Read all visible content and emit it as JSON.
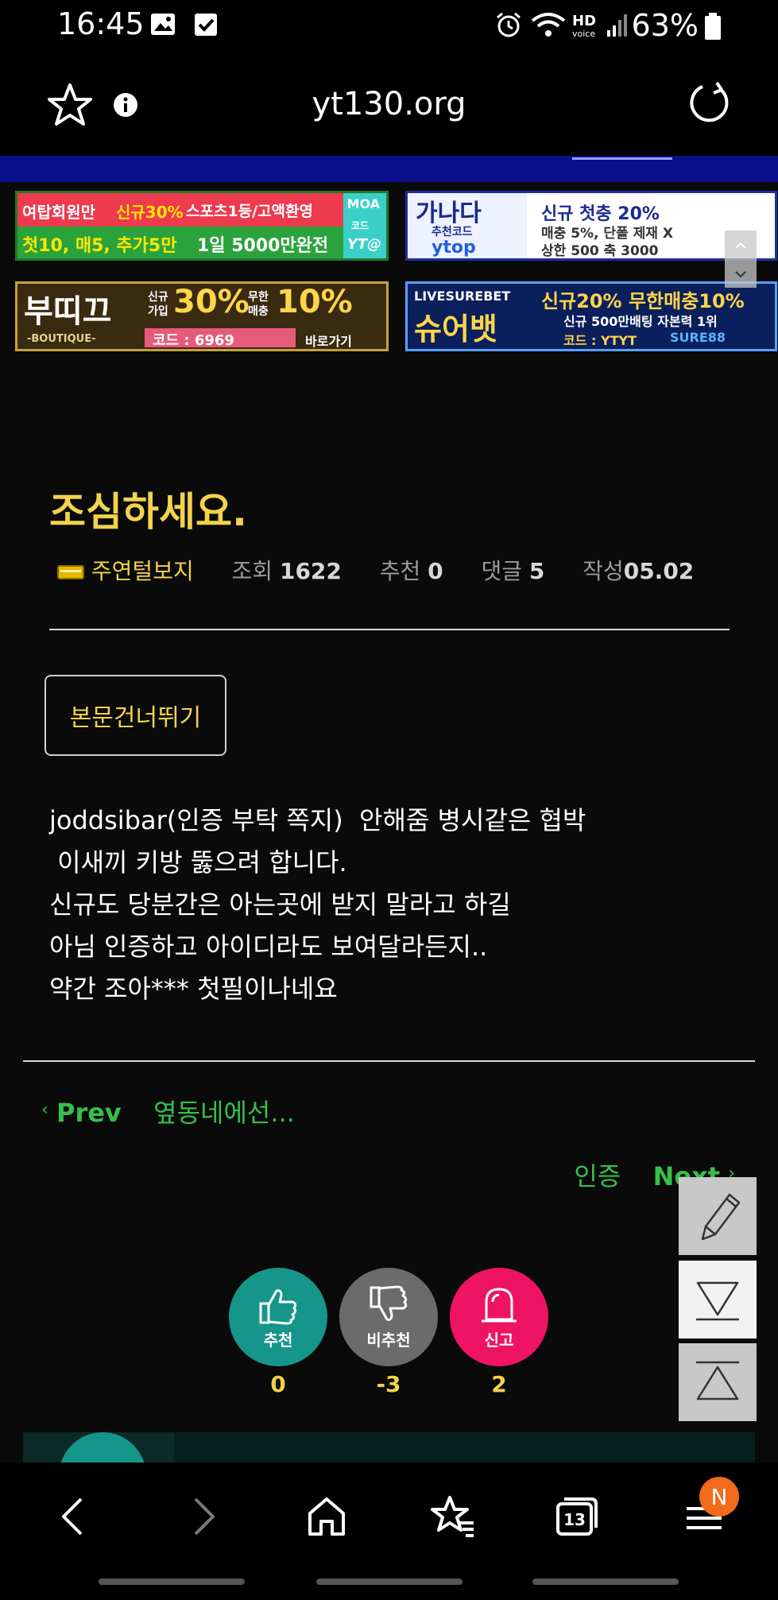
{
  "status_bar": {
    "time": "16:45",
    "battery": "63%"
  },
  "browser": {
    "url": "yt130.org",
    "tab_count": "13",
    "menu_badge": "N"
  },
  "banners": [
    {
      "line1a": "여탑회원만",
      "line1b": "신규30%",
      "line1c": "스포츠1등/고액환영",
      "line2": "첫10, 매5, 추가5만",
      "line2b": "1일 5000만완전",
      "tag1": "MOA",
      "tag2": "코드",
      "tag3": "YT@"
    },
    {
      "brand": "가나다",
      "sub1": "추천코드",
      "sub2": "ytop",
      "line1": "신규 첫충 20%",
      "line2": "매충 5%, 단폴 제재 X",
      "line3": "상한 500 축 3000"
    },
    {
      "brand": "부띠끄",
      "brand_sub": "-BOUTIQUE-",
      "s1": "신규",
      "s2": "가입",
      "pct1": "30%",
      "s3": "무한",
      "s4": "매충",
      "pct2": "10%",
      "code": "코드 : 6969",
      "go": "바로가기"
    },
    {
      "top": "LIVESUREBET",
      "brand": "슈어뱃",
      "line1": "신규20% 무한매충10%",
      "line2": "신규 500만배팅 자본력 1위",
      "code": "코드 : YTYT",
      "tg": "SURE88"
    }
  ],
  "post": {
    "title": "조심하세요.",
    "author": "주연털보지",
    "views_label": "조회",
    "views": "1622",
    "recommend_label": "추천",
    "recommend": "0",
    "comments_label": "댓글",
    "comments": "5",
    "date_label": "작성",
    "date": "05.02",
    "skip_label": "본문건너뛰기",
    "body": "joddsibar(인증 부탁 쪽지)  안해줌 병시같은 협박\n 이새끼 키방 뚫으려 합니다.\n신규도 당분간은 아는곳에 받지 말라고 하길\n아님 인증하고 아이디라도 보여달라든지..\n약간 조아*** 첫필이나네요"
  },
  "nav": {
    "prev_label": "Prev",
    "prev_title": "옆동네에선...",
    "next_label": "Next",
    "next_title": "인증"
  },
  "reactions": [
    {
      "label": "추천",
      "count": "0",
      "color": "#16958a"
    },
    {
      "label": "비추천",
      "count": "-3",
      "color": "#6b6b6b"
    },
    {
      "label": "신고",
      "count": "2",
      "color": "#ee1463"
    }
  ],
  "colors": {
    "accent_yellow": "#f2d34a",
    "link_green": "#35c04a",
    "band_blue": "#0a0f8c"
  }
}
